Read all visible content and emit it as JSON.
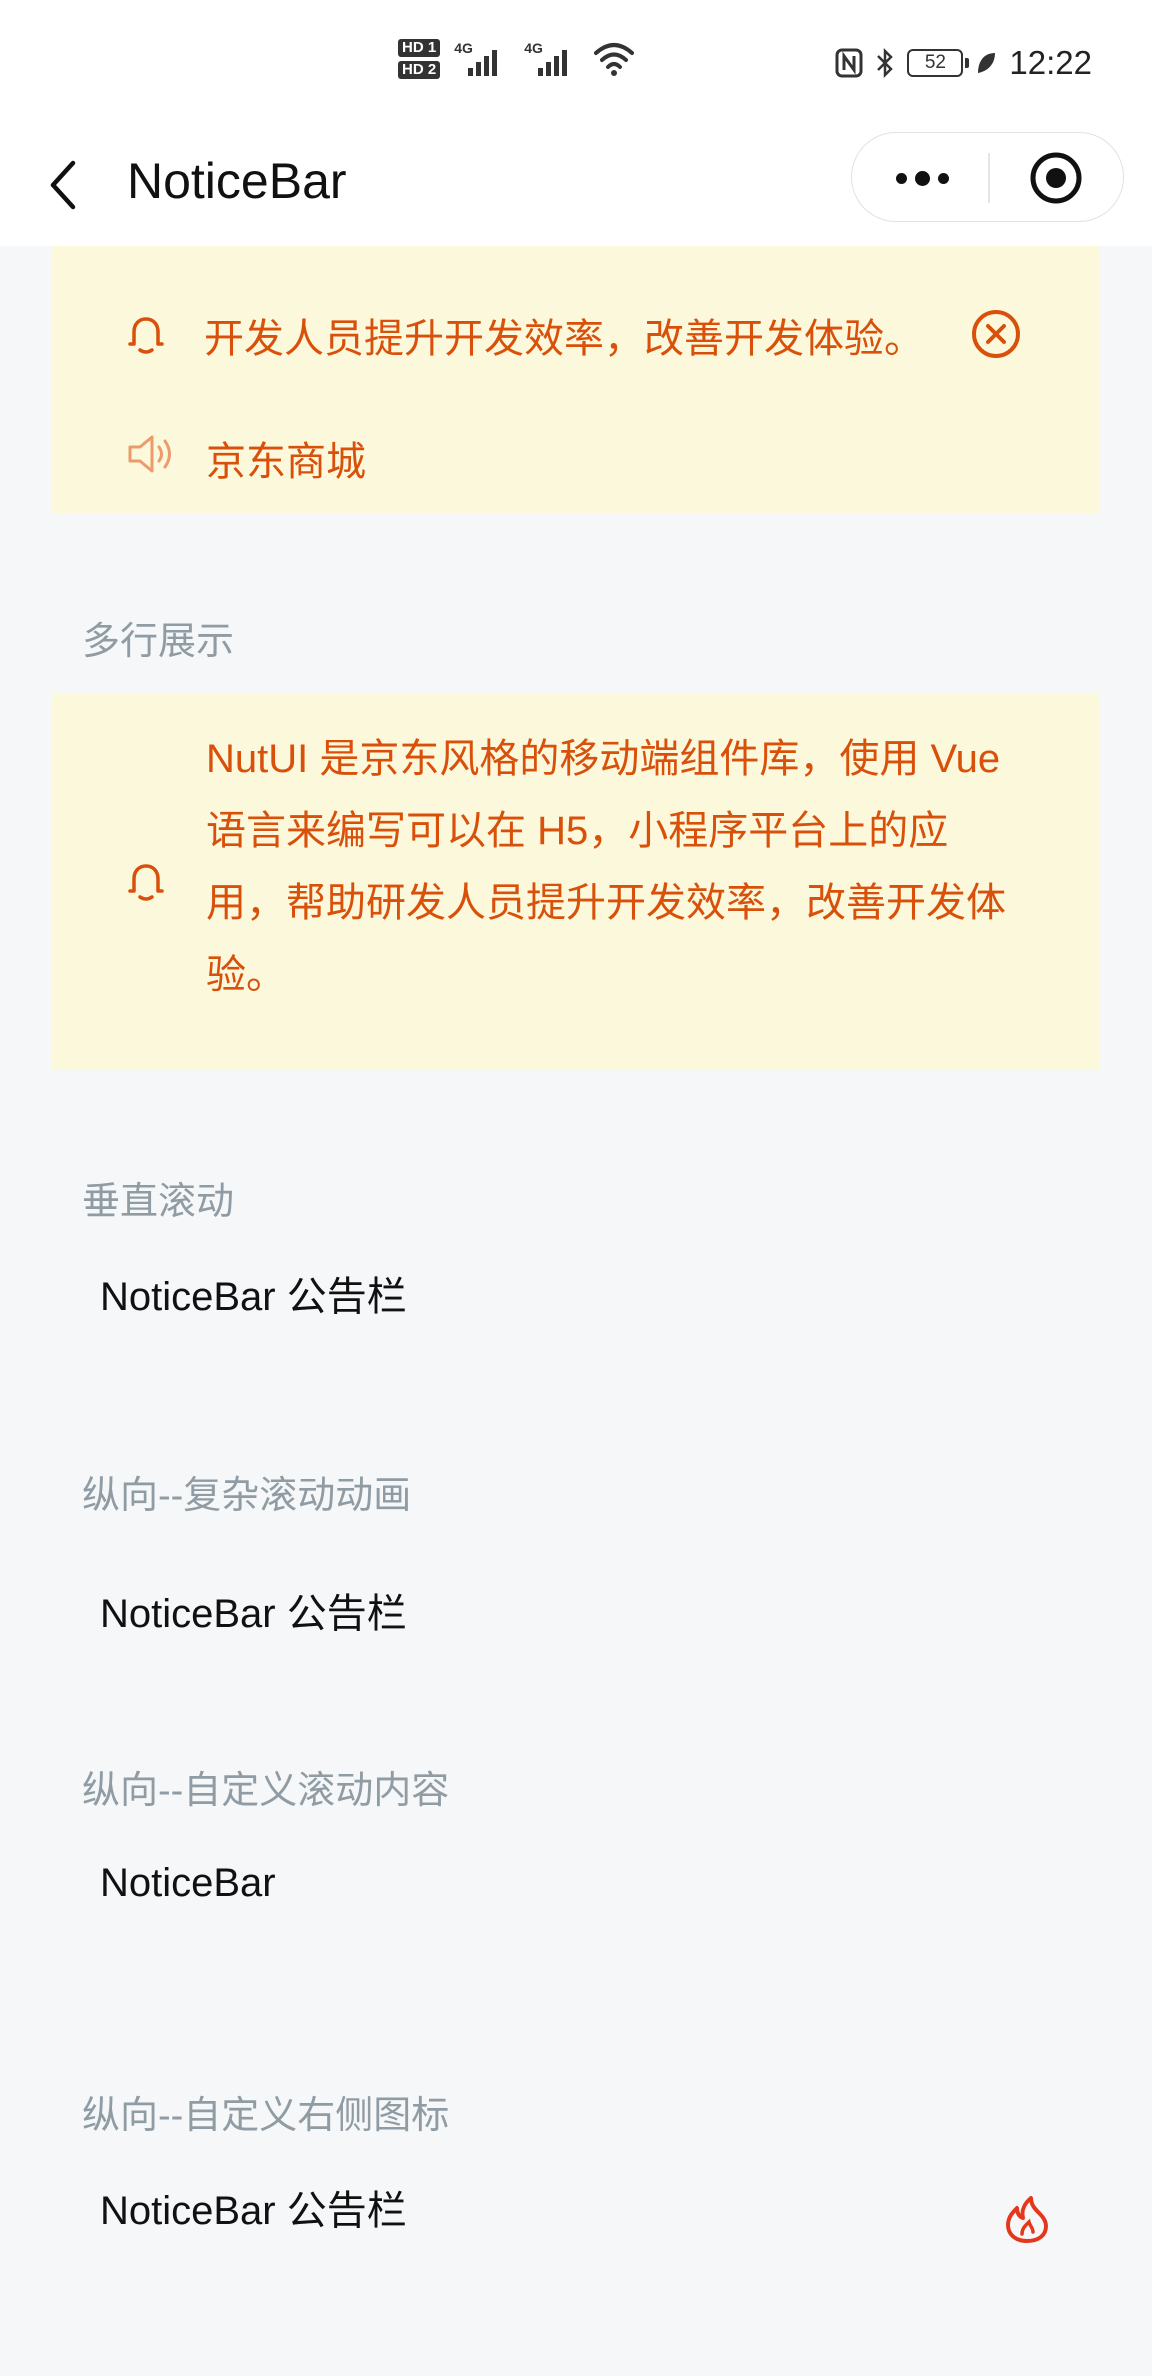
{
  "status_bar": {
    "hd1": "HD 1",
    "hd2": "HD 2",
    "net1": "4G",
    "net2": "4G",
    "battery": "52",
    "time": "12:22",
    "icons": [
      "nfc-icon",
      "bluetooth-icon",
      "leaf-icon",
      "wifi-icon",
      "signal-icon"
    ]
  },
  "nav": {
    "title": "NoticeBar",
    "back_icon": "chevron-left-icon",
    "more_icon": "more-dots-icon",
    "close_icon": "target-circle-icon"
  },
  "top_notice": {
    "line1": "开发人员提升开发效率，改善开发体验。",
    "line2": "京东商城",
    "icons": [
      "bell-icon",
      "close-circle-icon",
      "speaker-icon"
    ]
  },
  "multiline": {
    "title": "多行展示",
    "lines": [
      "NutUI 是京东风格的移动端组件库，使用 Vue",
      "语言来编写可以在 H5，小程序平台上的应",
      "用，帮助研发人员提升开发效率，改善开发体",
      "验。"
    ]
  },
  "vertical": {
    "title": "垂直滚动",
    "text": "NoticeBar 公告栏"
  },
  "complex": {
    "title": "纵向--复杂滚动动画",
    "text": "NoticeBar 公告栏"
  },
  "custom_content": {
    "title": "纵向--自定义滚动内容",
    "text": "NoticeBar"
  },
  "custom_icon": {
    "title": "纵向--自定义右侧图标",
    "text": "NoticeBar 公告栏",
    "icon": "fire-icon"
  },
  "colors": {
    "notice_bg": "#fbf8db",
    "notice_text": "#d9500b",
    "section_title": "#909ca4",
    "page_bg": "#f6f7f9",
    "fire_icon": "#e5371c"
  }
}
